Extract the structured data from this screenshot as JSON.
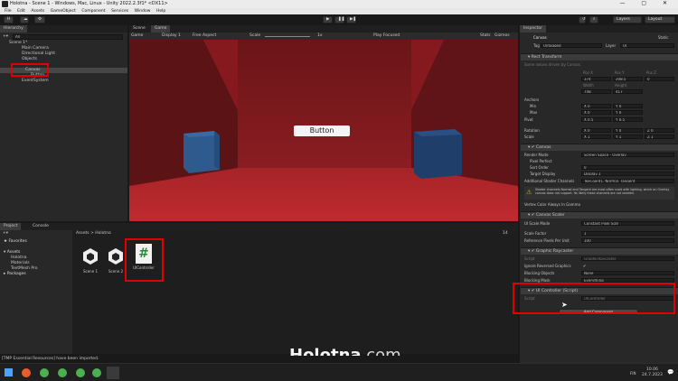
{
  "window": {
    "title": "Holotna - Scene 1 - Windows, Mac, Linux - Unity 2022.2.3f1* <DX11>",
    "controls": "—  ▢  ✕"
  },
  "menu": [
    "File",
    "Edit",
    "Assets",
    "GameObject",
    "Component",
    "Services",
    "Window",
    "Help"
  ],
  "toolbar": {
    "account": "H",
    "layers": "Layers",
    "layout": "Layout"
  },
  "hierarchy": {
    "tab": "Hierarchy",
    "search_placeholder": "All",
    "items": [
      "Scene 1*",
      "Main Camera",
      "Directional Light",
      "Objects",
      "Canvas",
      "Button",
      "EventSystem"
    ]
  },
  "scene_view": {
    "tabs": [
      "Scene",
      "Game"
    ],
    "toolbar": {
      "mode": "Game",
      "display": "Display 1",
      "aspect": "Free Aspect",
      "scale_label": "Scale",
      "scale_value": "1x",
      "play_focused": "Play Focused",
      "stats": "Stats",
      "gizmos": "Gizmos"
    },
    "button_text": "Button"
  },
  "project": {
    "tabs": [
      "Project",
      "Console"
    ],
    "breadcrumb": [
      "Assets",
      "Holotna"
    ],
    "tree": [
      "Favorites",
      "Assets",
      "Holotna",
      "Materials",
      "TextMesh Pro",
      "Packages"
    ],
    "assets": [
      "Scene 1",
      "Scene 2",
      "UIController"
    ],
    "count": "14"
  },
  "watermark": {
    "bold": "Holotna",
    "light": ".com"
  },
  "status": "[TMP Essential Resources] have been imported.",
  "inspector": {
    "tab": "Inspector",
    "object_name": "Canvas",
    "static": "Static",
    "tag_label": "Tag",
    "tag": "Untagged",
    "layer_label": "Layer",
    "layer": "UI",
    "rect_transform": {
      "title": "Rect Transform",
      "note": "Some values driven by Canvas.",
      "pos_labels": [
        "Pos X",
        "Pos Y",
        "Pos Z"
      ],
      "pos": [
        "374",
        "208.5",
        "0"
      ],
      "size_labels": [
        "Width",
        "Height"
      ],
      "size": [
        "748",
        "417"
      ],
      "anchors": "Anchors",
      "min": "Min",
      "min_x": "X 0",
      "min_y": "Y 0",
      "max": "Max",
      "max_x": "X 0",
      "max_y": "Y 0",
      "pivot": "Pivot",
      "pivot_x": "X 0.5",
      "pivot_y": "Y 0.5",
      "rotation": "Rotation",
      "rot_x": "X 0",
      "rot_y": "Y 0",
      "rot_z": "Z 0",
      "scale": "Scale",
      "scale_x": "X 1",
      "scale_y": "Y 1",
      "scale_z": "Z 1"
    },
    "canvas": {
      "title": "Canvas",
      "render_mode_label": "Render Mode",
      "render_mode": "Screen Space - Overlay",
      "pixel_perfect": "Pixel Perfect",
      "sort_order_label": "Sort Order",
      "sort_order": "0",
      "target_display_label": "Target Display",
      "target_display": "Display 1",
      "shader_channels_label": "Additional Shader Channels",
      "shader_channels": "TexCoord1, Normal, Tangent",
      "warning": "Shader channels Normal and Tangent are most often used with lighting, which an Overlay canvas does not support. Its likely these channels are not needed.",
      "vertex_color": "Vertex Color Always In Gamma"
    },
    "canvas_scaler": {
      "title": "Canvas Scaler",
      "ui_scale_mode_label": "UI Scale Mode",
      "ui_scale_mode": "Constant Pixel Size",
      "scale_factor_label": "Scale Factor",
      "scale_factor": "1",
      "ref_ppu_label": "Reference Pixels Per Unit",
      "ref_ppu": "100"
    },
    "graphic_raycaster": {
      "title": "Graphic Raycaster",
      "script_label": "Script",
      "script": "GraphicRaycaster",
      "ignore_label": "Ignore Reversed Graphics",
      "blocking_label": "Blocking Objects",
      "blocking": "None",
      "mask_label": "Blocking Mask",
      "mask": "Everything"
    },
    "ui_controller": {
      "title": "UI Controller (Script)",
      "script_label": "Script",
      "script": "UIController"
    },
    "add_component": "Add Component"
  },
  "clock": {
    "time": "10.06",
    "date": "24.7.2023",
    "lang": "FIN"
  }
}
